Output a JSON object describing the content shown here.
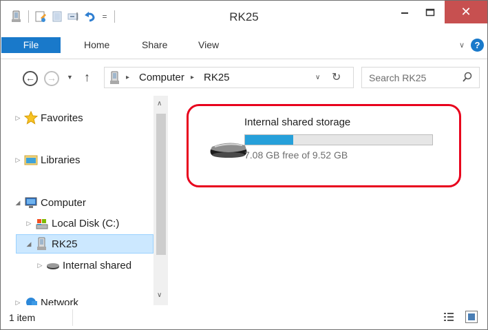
{
  "window": {
    "title": "RK25",
    "minimize_glyph": "–",
    "maximize_glyph": "☐",
    "close_glyph": "✕"
  },
  "quick_access": {
    "icons": [
      "properties-icon",
      "new-folder-icon",
      "undo-icon"
    ],
    "customize_glyph": "="
  },
  "ribbon": {
    "tabs": [
      {
        "label": "File",
        "active": true
      },
      {
        "label": "Home"
      },
      {
        "label": "Share"
      },
      {
        "label": "View"
      }
    ],
    "expand_glyph": "∨",
    "help_glyph": "?"
  },
  "navigation": {
    "back_glyph": "←",
    "forward_glyph": "→",
    "recent_glyph": "▼",
    "up_glyph": "↑",
    "breadcrumb": [
      "Computer",
      "RK25"
    ],
    "breadcrumb_separator": "▸",
    "dropdown_glyph": "∨",
    "refresh_glyph": "↻"
  },
  "search": {
    "placeholder": "Search RK25"
  },
  "nav_pane": {
    "items": [
      {
        "label": "Favorites",
        "icon": "star-icon",
        "expander": "▷"
      },
      {
        "label": "Libraries",
        "icon": "libraries-folder-icon",
        "expander": "▷"
      },
      {
        "label": "Computer",
        "icon": "computer-icon",
        "expander": "◢"
      },
      {
        "label": "Local Disk (C:)",
        "icon": "local-disk-icon",
        "expander": "▷"
      },
      {
        "label": "RK25",
        "icon": "portable-device-icon",
        "expander": "◢",
        "selected": true
      },
      {
        "label": "Internal shared",
        "icon": "drive-icon",
        "expander": "▷"
      },
      {
        "label": "Network",
        "icon": "network-icon",
        "expander": "▷"
      }
    ],
    "scroll_up_glyph": "∧",
    "scroll_down_glyph": "∨"
  },
  "content": {
    "drives": [
      {
        "name": "Internal shared storage",
        "free_text": "7.08 GB free of 9.52 GB",
        "used_fraction": 0.256,
        "bar_color": "#26a0da",
        "highlight_color": "#e8001c"
      }
    ]
  },
  "status": {
    "item_count": "1 item"
  },
  "colors": {
    "accent": "#1979ca",
    "close_button": "#c75050",
    "selection": "#cce8ff"
  }
}
